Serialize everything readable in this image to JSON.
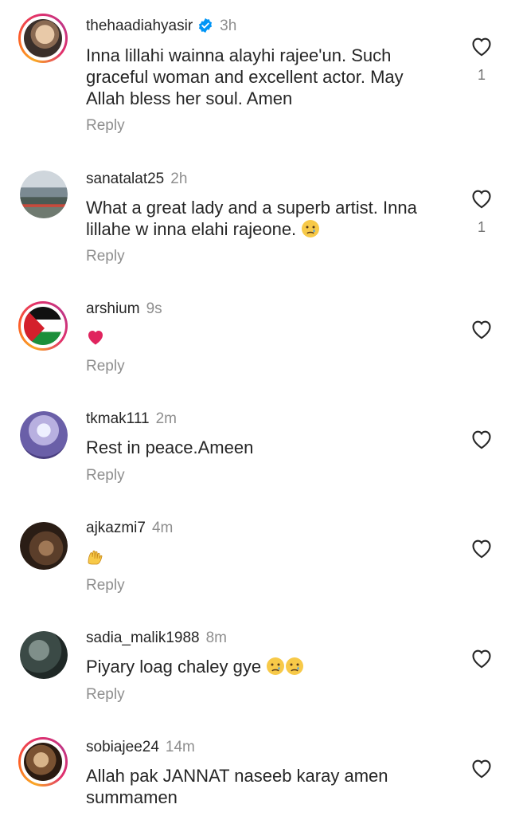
{
  "comments": [
    {
      "username": "thehaadiahyasir",
      "time": "3h",
      "verified": true,
      "text": "Inna lillahi wainna alayhi rajee'un. Such graceful woman and excellent actor. May Allah bless her soul. Amen",
      "reply": "Reply",
      "likes": "1",
      "avatar_icon": "woman-portrait"
    },
    {
      "username": "sanatalat25",
      "time": "2h",
      "text": "What a great lady and a superb artist. Inna lillahe w inna elahi rajeone.",
      "emojis": [
        "crying-face"
      ],
      "reply": "Reply",
      "likes": "1",
      "avatar_icon": "outdoor-photo"
    },
    {
      "username": "arshium",
      "time": "9s",
      "text": "",
      "emojis": [
        "red-heart"
      ],
      "reply": "Reply",
      "likes": "",
      "avatar_icon": "palestine-flag"
    },
    {
      "username": "tkmak111",
      "time": "2m",
      "text": "Rest in peace.Ameen",
      "reply": "Reply",
      "likes": "",
      "avatar_icon": "window-photo"
    },
    {
      "username": "ajkazmi7",
      "time": "4m",
      "text": "",
      "emojis": [
        "raised-hands"
      ],
      "reply": "Reply",
      "likes": "",
      "avatar_icon": "horse-photo"
    },
    {
      "username": "sadia_malik1988",
      "time": "8m",
      "text": "Piyary loag chaley gye",
      "emojis": [
        "crying-face",
        "crying-face"
      ],
      "reply": "Reply",
      "likes": "",
      "avatar_icon": "crowd-photo"
    },
    {
      "username": "sobiajee24",
      "time": "14m",
      "text": "Allah pak JANNAT naseeb karay amen summamen",
      "reply": "",
      "likes": "",
      "avatar_icon": "portrait-photo"
    }
  ],
  "colors": {
    "text": "#262626",
    "muted": "#8e8e8e",
    "verified": "#0095f6",
    "heart": "#e0245e"
  }
}
